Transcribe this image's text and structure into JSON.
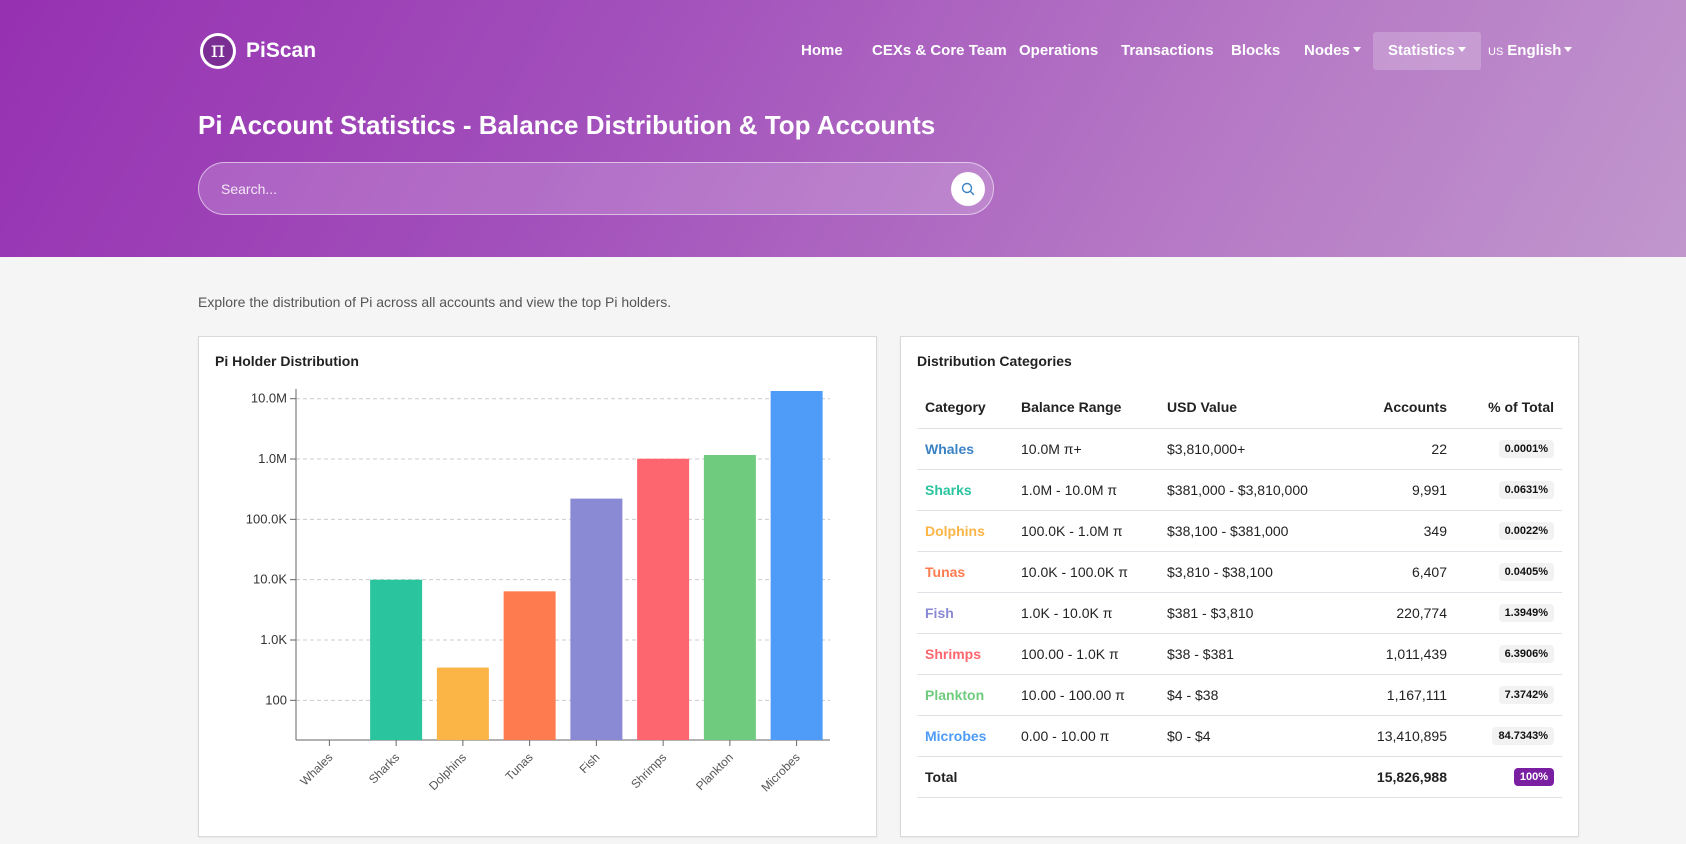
{
  "brand": {
    "name": "PiScan",
    "logo_glyph": "π"
  },
  "nav": {
    "home": "Home",
    "cexs": "CEXs & Core Team",
    "operations": "Operations",
    "transactions": "Transactions",
    "blocks": "Blocks",
    "nodes": "Nodes",
    "statistics": "Statistics",
    "lang_flag": "US",
    "language": "English"
  },
  "page": {
    "title": "Pi Account Statistics - Balance Distribution & Top Accounts",
    "intro": "Explore the distribution of Pi across all accounts and view the top Pi holders."
  },
  "search": {
    "placeholder": "Search...",
    "value": ""
  },
  "colors": {
    "whales": "#3b82c4",
    "sharks": "#2ac49f",
    "dolphins": "#fbb546",
    "tunas": "#fd7b4f",
    "fish": "#8a89d4",
    "shrimps": "#fd666e",
    "plankton": "#6fcb7e",
    "microbes": "#4e9cf7"
  },
  "chart_card": {
    "title": "Pi Holder Distribution"
  },
  "chart_data": {
    "type": "bar",
    "title": "Pi Holder Distribution",
    "categories": [
      "Whales",
      "Sharks",
      "Dolphins",
      "Tunas",
      "Fish",
      "Shrimps",
      "Plankton",
      "Microbes"
    ],
    "values": [
      22,
      9991,
      349,
      6407,
      220774,
      1011439,
      1167111,
      13410895
    ],
    "colors": [
      "#3b82c4",
      "#2ac49f",
      "#fbb546",
      "#fd7b4f",
      "#8a89d4",
      "#fd666e",
      "#6fcb7e",
      "#4e9cf7"
    ],
    "y_scale": "log",
    "ylim": [
      22,
      13410895
    ],
    "y_ticks": [
      100,
      1000,
      10000,
      100000,
      1000000,
      10000000
    ],
    "y_tick_labels": [
      "100",
      "1.0K",
      "10.0K",
      "100.0K",
      "1.0M",
      "10.0M"
    ],
    "grid": true,
    "xlabel": "",
    "ylabel": ""
  },
  "table_card": {
    "title": "Distribution Categories",
    "headers": {
      "category": "Category",
      "range": "Balance Range",
      "usd": "USD Value",
      "accounts": "Accounts",
      "pct": "% of Total"
    },
    "rows": [
      {
        "category": "Whales",
        "range": "10.0M π+",
        "usd": "$3,810,000+",
        "accounts": "22",
        "pct": "0.0001%",
        "color": "#3b82c4"
      },
      {
        "category": "Sharks",
        "range": "1.0M - 10.0M π",
        "usd": "$381,000 - $3,810,000",
        "accounts": "9,991",
        "pct": "0.0631%",
        "color": "#2ac49f"
      },
      {
        "category": "Dolphins",
        "range": "100.0K - 1.0M π",
        "usd": "$38,100 - $381,000",
        "accounts": "349",
        "pct": "0.0022%",
        "color": "#fbb546"
      },
      {
        "category": "Tunas",
        "range": "10.0K - 100.0K π",
        "usd": "$3,810 - $38,100",
        "accounts": "6,407",
        "pct": "0.0405%",
        "color": "#fd7b4f"
      },
      {
        "category": "Fish",
        "range": "1.0K - 10.0K π",
        "usd": "$381 - $3,810",
        "accounts": "220,774",
        "pct": "1.3949%",
        "color": "#8a89d4"
      },
      {
        "category": "Shrimps",
        "range": "100.00 - 1.0K π",
        "usd": "$38 - $381",
        "accounts": "1,011,439",
        "pct": "6.3906%",
        "color": "#fd666e"
      },
      {
        "category": "Plankton",
        "range": "10.00 - 100.00 π",
        "usd": "$4 - $38",
        "accounts": "1,167,111",
        "pct": "7.3742%",
        "color": "#6fcb7e"
      },
      {
        "category": "Microbes",
        "range": "0.00 - 10.00 π",
        "usd": "$0 - $4",
        "accounts": "13,410,895",
        "pct": "84.7343%",
        "color": "#4e9cf7"
      }
    ],
    "total": {
      "label": "Total",
      "accounts": "15,826,988",
      "pct": "100%"
    }
  }
}
